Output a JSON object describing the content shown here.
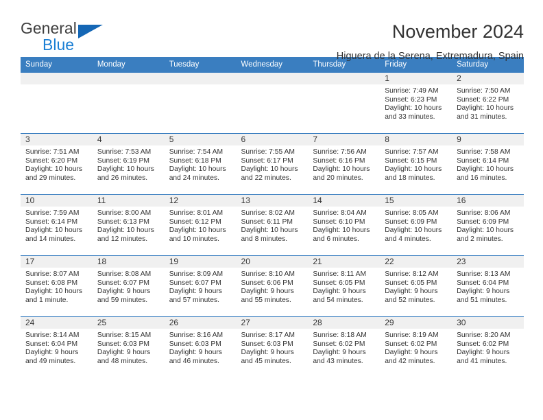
{
  "brand": {
    "name_part1": "General",
    "name_part2": "Blue",
    "logo_icon": "triangle-logo-icon",
    "colors": {
      "blue": "#1b7fd4",
      "dark": "#3f3f3f",
      "triangle": "#1567b5"
    }
  },
  "header": {
    "title": "November 2024",
    "subtitle": "Higuera de la Serena, Extremadura, Spain"
  },
  "calendar": {
    "header_color": "#3a7ec0",
    "daynum_band_color": "#f0f0f0",
    "weekday_headers": [
      "Sunday",
      "Monday",
      "Tuesday",
      "Wednesday",
      "Thursday",
      "Friday",
      "Saturday"
    ],
    "weeks": [
      [
        {
          "day": "",
          "sunrise": "",
          "sunset": "",
          "daylight_line1": "",
          "daylight_line2": "",
          "empty": true
        },
        {
          "day": "",
          "sunrise": "",
          "sunset": "",
          "daylight_line1": "",
          "daylight_line2": "",
          "empty": true
        },
        {
          "day": "",
          "sunrise": "",
          "sunset": "",
          "daylight_line1": "",
          "daylight_line2": "",
          "empty": true
        },
        {
          "day": "",
          "sunrise": "",
          "sunset": "",
          "daylight_line1": "",
          "daylight_line2": "",
          "empty": true
        },
        {
          "day": "",
          "sunrise": "",
          "sunset": "",
          "daylight_line1": "",
          "daylight_line2": "",
          "empty": true
        },
        {
          "day": "1",
          "sunrise": "Sunrise: 7:49 AM",
          "sunset": "Sunset: 6:23 PM",
          "daylight_line1": "Daylight: 10 hours",
          "daylight_line2": "and 33 minutes."
        },
        {
          "day": "2",
          "sunrise": "Sunrise: 7:50 AM",
          "sunset": "Sunset: 6:22 PM",
          "daylight_line1": "Daylight: 10 hours",
          "daylight_line2": "and 31 minutes."
        }
      ],
      [
        {
          "day": "3",
          "sunrise": "Sunrise: 7:51 AM",
          "sunset": "Sunset: 6:20 PM",
          "daylight_line1": "Daylight: 10 hours",
          "daylight_line2": "and 29 minutes."
        },
        {
          "day": "4",
          "sunrise": "Sunrise: 7:53 AM",
          "sunset": "Sunset: 6:19 PM",
          "daylight_line1": "Daylight: 10 hours",
          "daylight_line2": "and 26 minutes."
        },
        {
          "day": "5",
          "sunrise": "Sunrise: 7:54 AM",
          "sunset": "Sunset: 6:18 PM",
          "daylight_line1": "Daylight: 10 hours",
          "daylight_line2": "and 24 minutes."
        },
        {
          "day": "6",
          "sunrise": "Sunrise: 7:55 AM",
          "sunset": "Sunset: 6:17 PM",
          "daylight_line1": "Daylight: 10 hours",
          "daylight_line2": "and 22 minutes."
        },
        {
          "day": "7",
          "sunrise": "Sunrise: 7:56 AM",
          "sunset": "Sunset: 6:16 PM",
          "daylight_line1": "Daylight: 10 hours",
          "daylight_line2": "and 20 minutes."
        },
        {
          "day": "8",
          "sunrise": "Sunrise: 7:57 AM",
          "sunset": "Sunset: 6:15 PM",
          "daylight_line1": "Daylight: 10 hours",
          "daylight_line2": "and 18 minutes."
        },
        {
          "day": "9",
          "sunrise": "Sunrise: 7:58 AM",
          "sunset": "Sunset: 6:14 PM",
          "daylight_line1": "Daylight: 10 hours",
          "daylight_line2": "and 16 minutes."
        }
      ],
      [
        {
          "day": "10",
          "sunrise": "Sunrise: 7:59 AM",
          "sunset": "Sunset: 6:14 PM",
          "daylight_line1": "Daylight: 10 hours",
          "daylight_line2": "and 14 minutes."
        },
        {
          "day": "11",
          "sunrise": "Sunrise: 8:00 AM",
          "sunset": "Sunset: 6:13 PM",
          "daylight_line1": "Daylight: 10 hours",
          "daylight_line2": "and 12 minutes."
        },
        {
          "day": "12",
          "sunrise": "Sunrise: 8:01 AM",
          "sunset": "Sunset: 6:12 PM",
          "daylight_line1": "Daylight: 10 hours",
          "daylight_line2": "and 10 minutes."
        },
        {
          "day": "13",
          "sunrise": "Sunrise: 8:02 AM",
          "sunset": "Sunset: 6:11 PM",
          "daylight_line1": "Daylight: 10 hours",
          "daylight_line2": "and 8 minutes."
        },
        {
          "day": "14",
          "sunrise": "Sunrise: 8:04 AM",
          "sunset": "Sunset: 6:10 PM",
          "daylight_line1": "Daylight: 10 hours",
          "daylight_line2": "and 6 minutes."
        },
        {
          "day": "15",
          "sunrise": "Sunrise: 8:05 AM",
          "sunset": "Sunset: 6:09 PM",
          "daylight_line1": "Daylight: 10 hours",
          "daylight_line2": "and 4 minutes."
        },
        {
          "day": "16",
          "sunrise": "Sunrise: 8:06 AM",
          "sunset": "Sunset: 6:09 PM",
          "daylight_line1": "Daylight: 10 hours",
          "daylight_line2": "and 2 minutes."
        }
      ],
      [
        {
          "day": "17",
          "sunrise": "Sunrise: 8:07 AM",
          "sunset": "Sunset: 6:08 PM",
          "daylight_line1": "Daylight: 10 hours",
          "daylight_line2": "and 1 minute."
        },
        {
          "day": "18",
          "sunrise": "Sunrise: 8:08 AM",
          "sunset": "Sunset: 6:07 PM",
          "daylight_line1": "Daylight: 9 hours",
          "daylight_line2": "and 59 minutes."
        },
        {
          "day": "19",
          "sunrise": "Sunrise: 8:09 AM",
          "sunset": "Sunset: 6:07 PM",
          "daylight_line1": "Daylight: 9 hours",
          "daylight_line2": "and 57 minutes."
        },
        {
          "day": "20",
          "sunrise": "Sunrise: 8:10 AM",
          "sunset": "Sunset: 6:06 PM",
          "daylight_line1": "Daylight: 9 hours",
          "daylight_line2": "and 55 minutes."
        },
        {
          "day": "21",
          "sunrise": "Sunrise: 8:11 AM",
          "sunset": "Sunset: 6:05 PM",
          "daylight_line1": "Daylight: 9 hours",
          "daylight_line2": "and 54 minutes."
        },
        {
          "day": "22",
          "sunrise": "Sunrise: 8:12 AM",
          "sunset": "Sunset: 6:05 PM",
          "daylight_line1": "Daylight: 9 hours",
          "daylight_line2": "and 52 minutes."
        },
        {
          "day": "23",
          "sunrise": "Sunrise: 8:13 AM",
          "sunset": "Sunset: 6:04 PM",
          "daylight_line1": "Daylight: 9 hours",
          "daylight_line2": "and 51 minutes."
        }
      ],
      [
        {
          "day": "24",
          "sunrise": "Sunrise: 8:14 AM",
          "sunset": "Sunset: 6:04 PM",
          "daylight_line1": "Daylight: 9 hours",
          "daylight_line2": "and 49 minutes."
        },
        {
          "day": "25",
          "sunrise": "Sunrise: 8:15 AM",
          "sunset": "Sunset: 6:03 PM",
          "daylight_line1": "Daylight: 9 hours",
          "daylight_line2": "and 48 minutes."
        },
        {
          "day": "26",
          "sunrise": "Sunrise: 8:16 AM",
          "sunset": "Sunset: 6:03 PM",
          "daylight_line1": "Daylight: 9 hours",
          "daylight_line2": "and 46 minutes."
        },
        {
          "day": "27",
          "sunrise": "Sunrise: 8:17 AM",
          "sunset": "Sunset: 6:03 PM",
          "daylight_line1": "Daylight: 9 hours",
          "daylight_line2": "and 45 minutes."
        },
        {
          "day": "28",
          "sunrise": "Sunrise: 8:18 AM",
          "sunset": "Sunset: 6:02 PM",
          "daylight_line1": "Daylight: 9 hours",
          "daylight_line2": "and 43 minutes."
        },
        {
          "day": "29",
          "sunrise": "Sunrise: 8:19 AM",
          "sunset": "Sunset: 6:02 PM",
          "daylight_line1": "Daylight: 9 hours",
          "daylight_line2": "and 42 minutes."
        },
        {
          "day": "30",
          "sunrise": "Sunrise: 8:20 AM",
          "sunset": "Sunset: 6:02 PM",
          "daylight_line1": "Daylight: 9 hours",
          "daylight_line2": "and 41 minutes."
        }
      ]
    ]
  }
}
